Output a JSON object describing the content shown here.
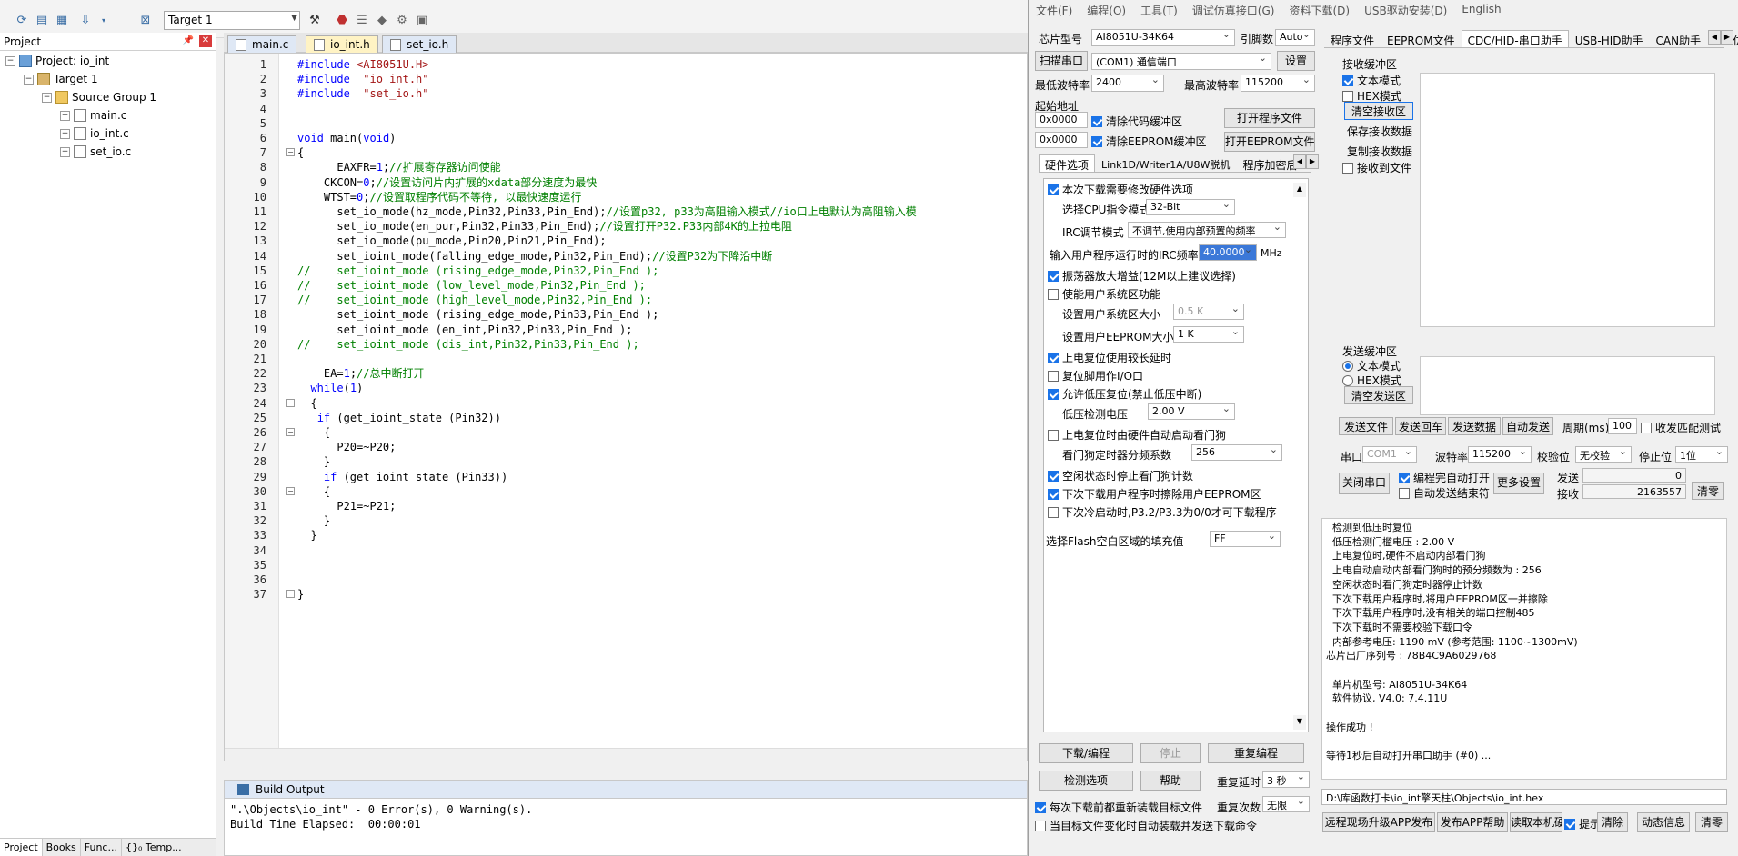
{
  "ide": {
    "target_name": "Target 1",
    "project_panel_title": "Project",
    "tree": {
      "project": "Project: io_int",
      "target": "Target 1",
      "group": "Source Group 1",
      "files": [
        "main.c",
        "io_int.c",
        "set_io.c"
      ]
    },
    "bottom_tabs": [
      "Project",
      "Books",
      "Func...",
      "{}₀ Temp..."
    ],
    "editor_tabs": [
      "main.c",
      "io_int.h",
      "set_io.h"
    ],
    "active_tab": "io_int.h",
    "code_lines": [
      "#include <AI8051U.H>",
      "#include  \"io_int.h\"",
      "#include  \"set_io.h\"",
      "",
      "",
      "void main(void)",
      "{",
      "      EAXFR=1;//扩展寄存器访问使能",
      "    CKCON=0;//设置访问片内扩展的xdata部分速度为最快",
      "    WTST=0;//设置取程序代码不等待, 以最快速度运行",
      "      set_io_mode(hz_mode,Pin32,Pin33,Pin_End);//设置p32, p33为高阻输入模式//io口上电默认为高阻输入模",
      "      set_io_mode(en_pur,Pin32,Pin33,Pin_End);//设置打开P32.P33内部4K的上拉电阻",
      "      set_io_mode(pu_mode,Pin20,Pin21,Pin_End);",
      "      set_ioint_mode(falling_edge_mode,Pin32,Pin_End);//设置P32为下降沿中断",
      "//    set_ioint_mode (rising_edge_mode,Pin32,Pin_End );",
      "//    set_ioint_mode (low_level_mode,Pin32,Pin_End );",
      "//    set_ioint_mode (high_level_mode,Pin32,Pin_End );",
      "      set_ioint_mode (rising_edge_mode,Pin33,Pin_End );",
      "      set_ioint_mode (en_int,Pin32,Pin33,Pin_End );",
      "//    set_ioint_mode (dis_int,Pin32,Pin33,Pin_End );",
      "",
      "    EA=1;//总中断打开",
      "  while(1)",
      "  {",
      "   if (get_ioint_state (Pin32))",
      "    {",
      "      P20=~P20;",
      "    }",
      "    if (get_ioint_state (Pin33))",
      "    {",
      "      P21=~P21;",
      "    }",
      "  }",
      "",
      "",
      "",
      "}"
    ],
    "build_output_title": "Build Output",
    "build_lines": [
      "\".\\Objects\\io_int\" - 0 Error(s), 0 Warning(s).",
      "Build Time Elapsed:  00:00:01"
    ]
  },
  "stc": {
    "menu": [
      "文件(F)",
      "编程(O)",
      "工具(T)",
      "调试仿真接口(G)",
      "资料下载(D)",
      "USB驱动安装(D)",
      "English"
    ],
    "chip_label": "芯片型号",
    "chip_value": "AI8051U-34K64",
    "pins_label": "引脚数",
    "pins_value": "Auto",
    "scan_button": "扫描串口",
    "port_value": "(COM1) 通信端口",
    "settings_button": "设置",
    "min_baud_label": "最低波特率",
    "min_baud_value": "2400",
    "max_baud_label": "最高波特率",
    "max_baud_value": "115200",
    "start_addr_label": "起始地址",
    "addr1": "0x0000",
    "addr2": "0x0000",
    "clear_code_buf": "清除代码缓冲区",
    "clear_eeprom_buf": "清除EEPROM缓冲区",
    "open_prog_file": "打开程序文件",
    "open_eeprom_file": "打开EEPROM文件",
    "left_tabs": [
      "硬件选项",
      "Link1D/Writer1A/U8W脱机",
      "程序加密后"
    ],
    "hw": {
      "opt_modify": "本次下载需要修改硬件选项",
      "cpu_mode_label": "选择CPU指令模式",
      "cpu_mode_value": "32-Bit",
      "irc_mode_label": "IRC调节模式",
      "irc_mode_value": "不调节,使用内部预置的频率",
      "irc_freq_label": "输入用户程序运行时的IRC频率",
      "irc_freq_value": "40.0000",
      "irc_unit": "MHz",
      "osc_gain": "振荡器放大增益(12M以上建议选择)",
      "user_sys": "使能用户系统区功能",
      "sys_size_label": "设置用户系统区大小",
      "sys_size_value": "0.5 K",
      "eeprom_size_label": "设置用户EEPROM大小",
      "eeprom_size_value": "1  K",
      "long_delay": "上电复位使用较长延时",
      "reset_io": "复位脚用作I/O口",
      "lvr": "允许低压复位(禁止低压中断)",
      "lvd_label": "低压检测电压",
      "lvd_value": "2.00 V",
      "wdt_auto": "上电复位时由硬件自动启动看门狗",
      "wdt_div_label": "看门狗定时器分频系数",
      "wdt_div_value": "256",
      "wdt_idle": "空闲状态时停止看门狗计数",
      "erase_eeprom": "下次下载用户程序时擦除用户EEPROM区",
      "p32p33": "下次冷启动时,P3.2/P3.3为0/0才可下载程序",
      "fill_label": "选择Flash空白区域的填充值",
      "fill_value": "FF"
    },
    "btn_download": "下载/编程",
    "btn_stop": "停止",
    "btn_reprogram": "重复编程",
    "btn_detect": "检测选项",
    "btn_help": "帮助",
    "repeat_delay_label": "重复延时",
    "repeat_delay_value": "3 秒",
    "repeat_count_label": "重复次数",
    "repeat_count_value": "无限",
    "reload_before": "每次下载前都重新装载目标文件",
    "auto_reload": "当目标文件变化时自动装载并发送下载命令",
    "right_tabs": [
      "程序文件",
      "EEPROM文件",
      "CDC/HID-串口助手",
      "USB-HID助手",
      "CAN助手",
      "Keil仿真"
    ],
    "rx": {
      "title": "接收缓冲区",
      "text_mode": "文本模式",
      "hex_mode": "HEX模式",
      "clear": "清空接收区",
      "save": "保存接收数据",
      "copy": "复制接收数据",
      "to_file": "接收到文件"
    },
    "tx": {
      "title": "发送缓冲区",
      "text_mode": "文本模式",
      "hex_mode": "HEX模式",
      "clear": "清空发送区"
    },
    "tx_buttons": [
      "发送文件",
      "发送回车",
      "发送数据",
      "自动发送"
    ],
    "period_label": "周期(ms)",
    "period_value": "100",
    "match_label": "收发匹配测试",
    "port_label": "串口",
    "port_short": "COM1",
    "baud_label": "波特率",
    "baud_value": "115200",
    "parity_label": "校验位",
    "parity_value": "无校验",
    "stop_label": "停止位",
    "stop_value": "1位",
    "close_port": "关闭串口",
    "auto_open": "编程完自动打开",
    "auto_send_end": "自动发送结束符",
    "more_settings": "更多设置",
    "send_label": "发送",
    "send_count": "0",
    "recv_label": "接收",
    "recv_count": "2163557",
    "clear_counts": "清零",
    "log_lines": [
      "  检测到低压时复位",
      "  低压检测门槛电压 : 2.00 V",
      "  上电复位时,硬件不启动内部看门狗",
      "  上电自动启动内部看门狗时的预分频数为 : 256",
      "  空闲状态时看门狗定时器停止计数",
      "  下次下载用户程序时,将用户EEPROM区一并擦除",
      "  下次下载用户程序时,没有相关的端口控制485",
      "  下次下载时不需要校验下载口令",
      "  内部参考电压: 1190 mV (参考范围: 1100~1300mV)",
      "芯片出厂序列号 : 78B4C9A6029768",
      "",
      "  单片机型号: AI8051U-34K64",
      "  软件协议, V4.0: 7.4.11U",
      "",
      "操作成功 !",
      "",
      "等待1秒后自动打开串口助手 (#0) ..."
    ],
    "file_path": "D:\\库函数打卡\\io_int擎天柱\\Objects\\io_int.hex",
    "bottom_buttons": [
      "远程现场升级APP发布",
      "发布APP帮助",
      "读取本机硬",
      "提示",
      "清除",
      "动态信息",
      "清零"
    ]
  }
}
